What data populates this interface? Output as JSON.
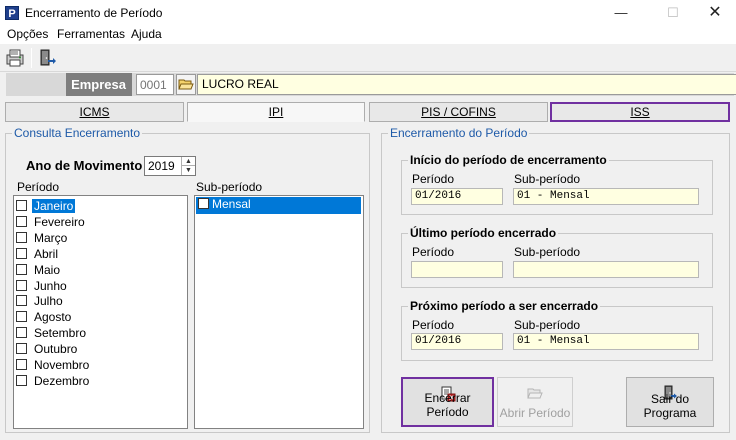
{
  "window": {
    "title": "Encerramento de Período",
    "app_icon": "P",
    "controls": {
      "minimize": "—",
      "maximize": "☐",
      "close": "✕"
    }
  },
  "menu": [
    "Opções",
    "Ferramentas",
    "Ajuda"
  ],
  "toolbar": {
    "icons": [
      "report-icon",
      "exit-door-icon"
    ]
  },
  "empresa": {
    "label": "Empresa",
    "code_placeholder": "0001",
    "name": "LUCRO REAL"
  },
  "tabs": [
    {
      "label": "ICMS",
      "active": false,
      "highlighted": false
    },
    {
      "label": "IPI",
      "active": true,
      "highlighted": false
    },
    {
      "label": "PIS / COFINS",
      "active": false,
      "highlighted": false
    },
    {
      "label": "ISS",
      "active": false,
      "highlighted": true
    }
  ],
  "consulta": {
    "title": "Consulta Encerramento",
    "ano_label": "Ano de Movimento",
    "ano_value": "2019",
    "periodo_header": "Período",
    "subperiodo_header": "Sub-período",
    "months": [
      "Janeiro",
      "Fevereiro",
      "Março",
      "Abril",
      "Maio",
      "Junho",
      "Julho",
      "Agosto",
      "Setembro",
      "Outubro",
      "Novembro",
      "Dezembro"
    ],
    "selected_month": "Janeiro",
    "subperiods": [
      "Mensal"
    ]
  },
  "encerramento": {
    "title": "Encerramento do Período",
    "inicio": {
      "title": "Início do período de encerramento",
      "periodo_label": "Período",
      "subperiodo_label": "Sub-período",
      "periodo": "01/2016",
      "subperiodo": "01 - Mensal"
    },
    "ultimo": {
      "title": "Último período encerrado",
      "periodo_label": "Período",
      "subperiodo_label": "Sub-período",
      "periodo": "",
      "subperiodo": ""
    },
    "proximo": {
      "title": "Próximo período a ser encerrado",
      "periodo_label": "Período",
      "subperiodo_label": "Sub-período",
      "periodo": "01/2016",
      "subperiodo": "01 - Mensal"
    }
  },
  "buttons": {
    "encerrar": "Encerrar Período",
    "abrir": "Abrir Período",
    "sair": "Sair do Programa"
  },
  "colors": {
    "accent_highlight": "#7030a0",
    "selection": "#0078d7",
    "readonly_bg": "#ffffe1",
    "group_title": "#1e5aa8"
  }
}
